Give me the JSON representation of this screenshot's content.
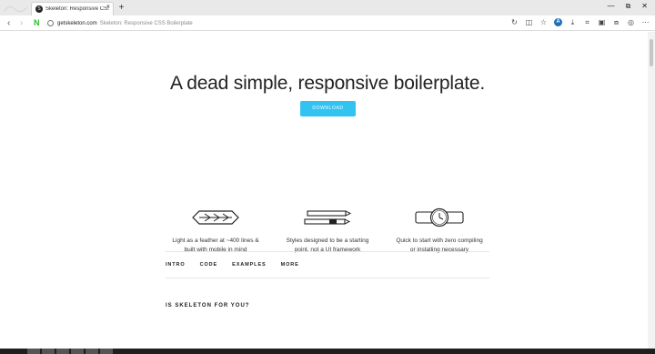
{
  "browser": {
    "tab": {
      "favicon_letter": "S",
      "title": "Skeleton: Responsive CSS",
      "close_glyph": "×"
    },
    "new_tab_glyph": "+",
    "window_controls": [
      "—",
      "⧉",
      "✕"
    ],
    "nav": {
      "back": "‹",
      "forward": "›",
      "extension_letter": "N",
      "extension_color": "#2dbb2d"
    },
    "address": {
      "host": "getskeleton.com",
      "page_title": "Skeleton: Responsive CSS Boilerplate"
    },
    "toolbar_icons": [
      "reload-icon",
      "reader-icon",
      "star-icon",
      "profile-icon",
      "download-icon",
      "crop-icon",
      "reading-list-icon",
      "collections-icon",
      "account-icon",
      "more-icon"
    ],
    "profile_letter": "A"
  },
  "hero": {
    "title": "A dead simple, responsive boilerplate.",
    "button_label": "DOWNLOAD",
    "button_color": "#33c3f0"
  },
  "features": [
    {
      "icon": "feather-icon",
      "text_line1": "Light as a feather at ~400 lines &",
      "text_line2": "built with mobile in mind"
    },
    {
      "icon": "pens-icon",
      "text_line1": "Styles designed to be a starting",
      "text_line2": "point, not a UI framework"
    },
    {
      "icon": "watch-icon",
      "text_line1": "Quick to start with zero compiling",
      "text_line2": "or installing necessary"
    }
  ],
  "subnav": [
    "INTRO",
    "CODE",
    "EXAMPLES",
    "MORE"
  ],
  "section": {
    "heading": "IS SKELETON FOR YOU?"
  }
}
